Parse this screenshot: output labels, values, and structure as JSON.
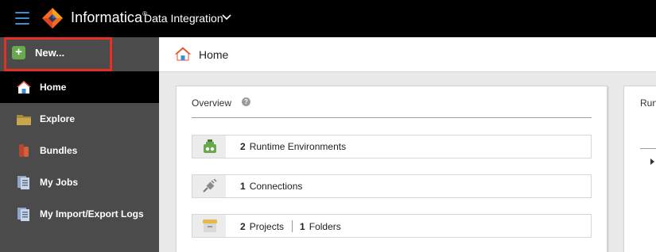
{
  "topbar": {
    "brand": "Informatica",
    "brand_mark": "®",
    "product": "Data Integration"
  },
  "sidebar": {
    "new_button": "New...",
    "items": [
      {
        "label": "Home",
        "icon": "home-icon"
      },
      {
        "label": "Explore",
        "icon": "folder-icon"
      },
      {
        "label": "Bundles",
        "icon": "bundle-icon"
      },
      {
        "label": "My Jobs",
        "icon": "jobs-icon"
      },
      {
        "label": "My Import/Export Logs",
        "icon": "logs-icon"
      }
    ]
  },
  "header": {
    "title": "Home"
  },
  "overview": {
    "title": "Overview",
    "help": "?",
    "runtime": {
      "count": "2",
      "label": "Runtime Environments"
    },
    "connections": {
      "count": "1",
      "label": "Connections"
    },
    "projects": {
      "count": "2",
      "label": "Projects"
    },
    "folders": {
      "count": "1",
      "label": "Folders"
    }
  },
  "right_panel": {
    "title": "Run"
  },
  "colors": {
    "accent_blue": "#3b8fd9",
    "highlight_red": "#e53023",
    "new_green": "#6aa84f",
    "sidebar_bg": "#4b4b4b"
  }
}
